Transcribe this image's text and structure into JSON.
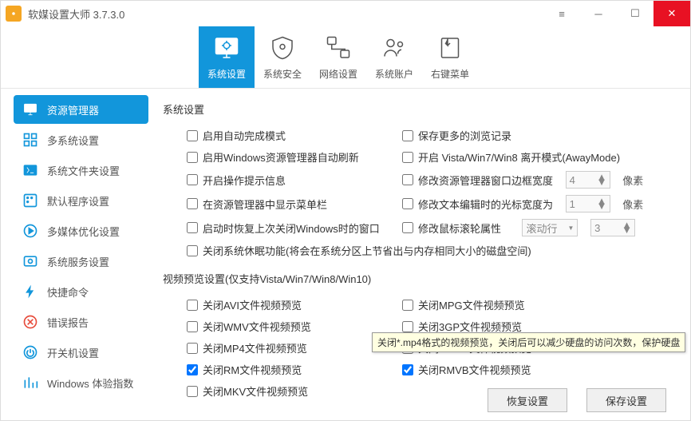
{
  "title": "软媒设置大师 3.7.3.0",
  "toolbar": {
    "t0": "系统设置",
    "t1": "系统安全",
    "t2": "网络设置",
    "t3": "系统账户",
    "t4": "右键菜单"
  },
  "sidebar": {
    "s0": "资源管理器",
    "s1": "多系统设置",
    "s2": "系统文件夹设置",
    "s3": "默认程序设置",
    "s4": "多媒体优化设置",
    "s5": "系统服务设置",
    "s6": "快捷命令",
    "s7": "错误报告",
    "s8": "开关机设置",
    "s9": "Windows 体验指数"
  },
  "sec1": {
    "title": "系统设置",
    "c0": "启用自动完成模式",
    "c1": "保存更多的浏览记录",
    "c2": "启用Windows资源管理器自动刷新",
    "c3": "开启 Vista/Win7/Win8 离开模式(AwayMode)",
    "c4": "开启操作提示信息",
    "c5": "修改资源管理器窗口边框宽度",
    "c5v": "4",
    "c5u": "像素",
    "c6": "在资源管理器中显示菜单栏",
    "c7": "修改文本编辑时的光标宽度为",
    "c7v": "1",
    "c7u": "像素",
    "c8": "启动时恢复上次关闭Windows时的窗口",
    "c9": "修改鼠标滚轮属性",
    "c9s": "滚动行",
    "c9n": "3",
    "c10": "关闭系统休眠功能(将会在系统分区上节省出与内存相同大小的磁盘空间)"
  },
  "sec2": {
    "title": "视频预览设置(仅支持Vista/Win7/Win8/Win10)",
    "c0": "关闭AVI文件视频预览",
    "c1": "关闭MPG文件视频预览",
    "c2": "关闭WMV文件视频预览",
    "c3": "关闭3GP文件视频预览",
    "c4": "关闭MP4文件视频预览",
    "c5": "关闭MPEG文件视频预览",
    "c6": "关闭RM文件视频预览",
    "c7": "关闭RMVB文件视频预览",
    "c8": "关闭MKV文件视频预览"
  },
  "tooltip": "关闭*.mp4格式的视频预览，关闭后可以减少硬盘的访问次数，保护硬盘",
  "btns": {
    "r": "恢复设置",
    "s": "保存设置"
  }
}
